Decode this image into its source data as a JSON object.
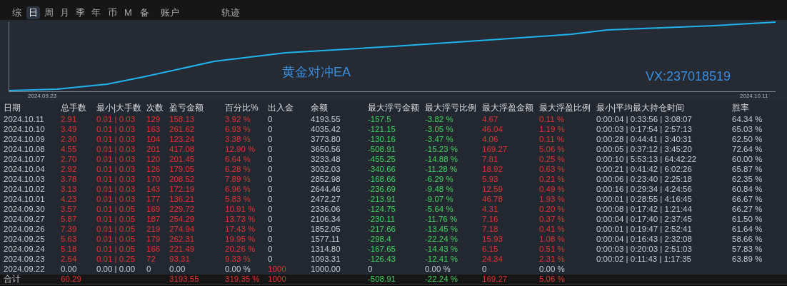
{
  "tabs": [
    {
      "label": "综",
      "selected": false
    },
    {
      "label": "日",
      "selected": true
    },
    {
      "label": "周",
      "selected": false
    },
    {
      "label": "月",
      "selected": false
    },
    {
      "label": "季",
      "selected": false
    },
    {
      "label": "年",
      "selected": false
    },
    {
      "label": "币",
      "selected": false
    },
    {
      "label": "M",
      "selected": false
    },
    {
      "label": "备",
      "selected": false
    },
    {
      "label": "账户",
      "selected": false
    },
    {
      "label": "轨迹",
      "selected": false
    }
  ],
  "chart": {
    "title": "黄金对冲EA",
    "contact": "VX:237018519",
    "start_label": "2024.09.23",
    "end_label": "2024.10.11"
  },
  "table": {
    "columns": [
      "日期",
      "总手数",
      "最小|大手数",
      "次数",
      "盈亏金额",
      "百分比%",
      "出入金",
      "余额",
      "最大浮亏金额",
      "最大浮亏比例",
      "最大浮盈金额",
      "最大浮盈比例",
      "最小|平均最大持仓时间",
      "胜率"
    ],
    "rows": [
      {
        "kind": "trade",
        "cells": [
          "2024.10.11",
          "2.91",
          "0.01 | 0.03",
          "129",
          "158.13",
          "3.92 %",
          "0",
          "4193.55",
          "-157.5",
          "-3.82 %",
          "4.67",
          "0.11 %",
          "0:00:04 | 0:33:56 | 3:08:07",
          "64.34 %"
        ]
      },
      {
        "kind": "trade",
        "cells": [
          "2024.10.10",
          "3.49",
          "0.01 | 0.03",
          "163",
          "261.62",
          "6.93 %",
          "0",
          "4035.42",
          "-121.15",
          "-3.05 %",
          "46.04",
          "1.19 %",
          "0:00:03 | 0:17:54 | 2:57:13",
          "65.03 %"
        ]
      },
      {
        "kind": "trade",
        "cells": [
          "2024.10.09",
          "2.30",
          "0.01 | 0.03",
          "104",
          "123.24",
          "3.38 %",
          "0",
          "3773.80",
          "-130.16",
          "-3.47 %",
          "4.06",
          "0.11 %",
          "0:00:28 | 0:44:41 | 3:40:31",
          "62.50 %"
        ]
      },
      {
        "kind": "trade",
        "cells": [
          "2024.10.08",
          "4.55",
          "0.01 | 0.03",
          "201",
          "417.08",
          "12.90 %",
          "0",
          "3650.56",
          "-508.91",
          "-15.23 %",
          "169.27",
          "5.06 %",
          "0:00:05 | 0:37:12 | 3:45:20",
          "72.64 %"
        ]
      },
      {
        "kind": "trade",
        "cells": [
          "2024.10.07",
          "2.70",
          "0.01 | 0.03",
          "120",
          "201.45",
          "6.64 %",
          "0",
          "3233.48",
          "-455.25",
          "-14.88 %",
          "7.81",
          "0.25 %",
          "0:00:10 | 5:53:13 | 64:42:22",
          "60.00 %"
        ]
      },
      {
        "kind": "trade",
        "cells": [
          "2024.10.04",
          "2.92",
          "0.01 | 0.03",
          "126",
          "179.05",
          "6.28 %",
          "0",
          "3032.03",
          "-340.66",
          "-11.28 %",
          "18.92",
          "0.63 %",
          "0:00:21 | 0:41:42 | 6:02:26",
          "65.87 %"
        ]
      },
      {
        "kind": "trade",
        "cells": [
          "2024.10.03",
          "3.78",
          "0.01 | 0.03",
          "170",
          "208.52",
          "7.89 %",
          "0",
          "2852.98",
          "-168.66",
          "-6.29 %",
          "5.93",
          "0.21 %",
          "0:00:06 | 0:23:40 | 2:25:18",
          "62.35 %"
        ]
      },
      {
        "kind": "trade",
        "cells": [
          "2024.10.02",
          "3.13",
          "0.01 | 0.03",
          "143",
          "172.19",
          "6.96 %",
          "0",
          "2644.46",
          "-236.69",
          "-9.48 %",
          "12.59",
          "0.49 %",
          "0:00:16 | 0:29:34 | 4:24:56",
          "60.84 %"
        ]
      },
      {
        "kind": "trade",
        "cells": [
          "2024.10.01",
          "4.23",
          "0.01 | 0.03",
          "177",
          "136.21",
          "5.83 %",
          "0",
          "2472.27",
          "-213.91",
          "-9.07 %",
          "46.78",
          "1.93 %",
          "0:00:01 | 0:28:55 | 4:16:45",
          "66.67 %"
        ]
      },
      {
        "kind": "trade",
        "cells": [
          "2024.09.30",
          "3.57",
          "0.01 | 0.05",
          "169",
          "229.72",
          "10.91 %",
          "0",
          "2336.06",
          "-124.75",
          "-5.64 %",
          "4.31",
          "0.20 %",
          "0:00:08 | 0:17:42 | 1:21:44",
          "66.27 %"
        ]
      },
      {
        "kind": "trade",
        "cells": [
          "2024.09.27",
          "5.87",
          "0.01 | 0.05",
          "187",
          "254.29",
          "13.73 %",
          "0",
          "2106.34",
          "-230.11",
          "-11.76 %",
          "7.16",
          "0.37 %",
          "0:00:04 | 0:17:40 | 2:37:45",
          "61.50 %"
        ]
      },
      {
        "kind": "trade",
        "cells": [
          "2024.09.26",
          "7.39",
          "0.01 | 0.05",
          "219",
          "274.94",
          "17.43 %",
          "0",
          "1852.05",
          "-217.66",
          "-13.45 %",
          "7.18",
          "0.41 %",
          "0:00:01 | 0:19:47 | 2:52:41",
          "61.64 %"
        ]
      },
      {
        "kind": "trade",
        "cells": [
          "2024.09.25",
          "5.63",
          "0.01 | 0.05",
          "179",
          "262.31",
          "19.95 %",
          "0",
          "1577.11",
          "-298.4",
          "-22.24 %",
          "15.93",
          "1.08 %",
          "0:00:04 | 0:16:43 | 2:32:08",
          "58.66 %"
        ]
      },
      {
        "kind": "trade",
        "cells": [
          "2024.09.24",
          "5.18",
          "0.01 | 0.05",
          "166",
          "221.49",
          "20.26 %",
          "0",
          "1314.80",
          "-167.65",
          "-14.43 %",
          "6.15",
          "0.51 %",
          "0:00:03 | 0:20:03 | 2:51:03",
          "57.83 %"
        ]
      },
      {
        "kind": "trade",
        "cells": [
          "2024.09.23",
          "2.64",
          "0.01 | 0.25",
          "72",
          "93.31",
          "9.33 %",
          "0",
          "1093.31",
          "-126.43",
          "-12.41 %",
          "24.34",
          "2.31 %",
          "0:00:02 | 0:11:43 | 1:17:35",
          "63.89 %"
        ]
      },
      {
        "kind": "deposit",
        "cells": [
          "2024.09.22",
          "0.00",
          "0.00 | 0.00",
          "0",
          "0.00",
          "0.00 %",
          "1000",
          "1000.00",
          "0",
          "0.00 %",
          "0",
          "0.00 %"
        ]
      }
    ],
    "total": {
      "label": "合计",
      "lots": "60.29",
      "profit": "3193.55",
      "percent": "319.35 %",
      "deposit": "1000",
      "max_float_loss": "-508.91",
      "max_float_loss_pct": "-22.24 %",
      "max_float_profit": "169.27",
      "max_float_profit_pct": "5.06 %"
    }
  }
}
